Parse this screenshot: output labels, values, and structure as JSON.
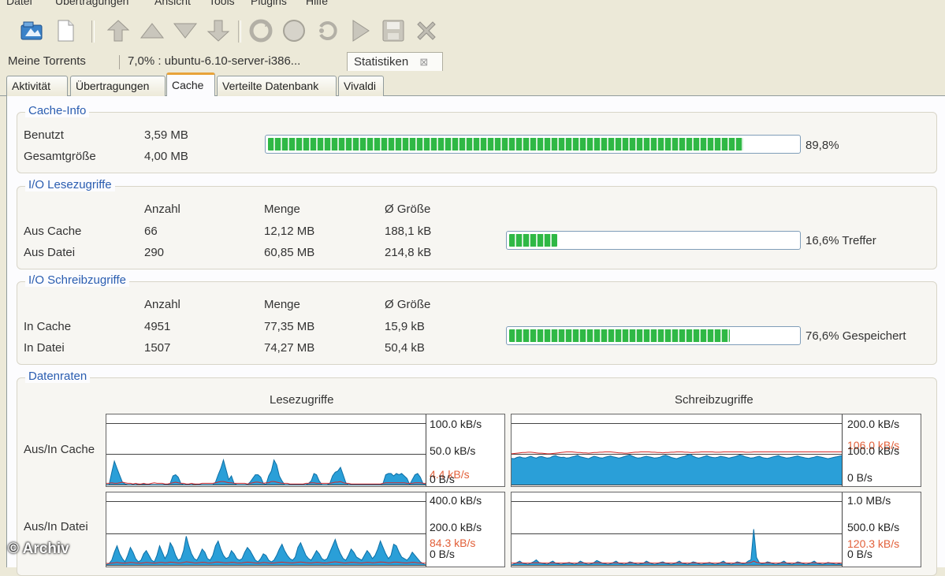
{
  "menubar": {
    "items": [
      "Datei",
      "Übertragungen",
      "Ansicht",
      "Tools",
      "Plugins",
      "Hilfe"
    ]
  },
  "toolbar": {
    "icons": [
      "open-torrent-icon",
      "new-torrent-icon",
      "move-top-icon",
      "move-up-icon",
      "move-down-icon",
      "move-bottom-icon",
      "run-icon",
      "start-icon",
      "stop-icon",
      "queue-icon",
      "save-icon",
      "remove-icon"
    ]
  },
  "doc_tabs": {
    "my_torrents": "Meine Torrents",
    "torrent": "7,0% : ubuntu-6.10-server-i386...",
    "statistics": "Statistiken",
    "close_glyph": "⊠"
  },
  "sub_tabs": [
    "Aktivität",
    "Übertragungen",
    "Cache",
    "Verteilte Datenbank",
    "Vivaldi"
  ],
  "cache_info": {
    "title": "Cache-Info",
    "used_label": "Benutzt",
    "used_value": "3,59 MB",
    "total_label": "Gesamtgröße",
    "total_value": "4,00 MB",
    "usage_percent": 89.8,
    "usage_text": "89,8%"
  },
  "io_read": {
    "title": "I/O Lesezugriffe",
    "headers": [
      "Anzahl",
      "Menge",
      "Ø Größe"
    ],
    "rows": [
      {
        "label": "Aus Cache",
        "count": "66",
        "amount": "12,12 MB",
        "avg": "188,1 kB"
      },
      {
        "label": "Aus Datei",
        "count": "290",
        "amount": "60,85 MB",
        "avg": "214,8 kB"
      }
    ],
    "percent": 16.6,
    "bar_text": "16,6% Treffer"
  },
  "io_write": {
    "title": "I/O Schreibzugriffe",
    "headers": [
      "Anzahl",
      "Menge",
      "Ø Größe"
    ],
    "rows": [
      {
        "label": "In Cache",
        "count": "4951",
        "amount": "77,35 MB",
        "avg": "15,9 kB"
      },
      {
        "label": "In Datei",
        "count": "1507",
        "amount": "74,27 MB",
        "avg": "50,4 kB"
      }
    ],
    "percent": 76.6,
    "bar_text": "76,6% Gespeichert"
  },
  "data_rates": {
    "title": "Datenraten",
    "read_header": "Lesezugriffe",
    "write_header": "Schreibzugriffe",
    "row_cache_label": "Aus/In Cache",
    "row_file_label": "Aus/In Datei",
    "read_cache_axis": {
      "top": "100.0 kB/s",
      "mid": "50.0 kB/s",
      "bottom": "0 B/s",
      "current": "4.4 kB/s"
    },
    "write_cache_axis": {
      "top": "200.0 kB/s",
      "mid": "100.0 kB/s",
      "bottom": "0 B/s",
      "current": "106.0 kB/s"
    },
    "read_file_axis": {
      "top": "400.0 kB/s",
      "mid": "200.0 kB/s",
      "bottom": "0 B/s",
      "current": "84.3 kB/s"
    },
    "write_file_axis": {
      "top": "1.0 MB/s",
      "mid": "500.0 kB/s",
      "bottom": "0 B/s",
      "current": "120.3 kB/s"
    }
  },
  "chart_data": [
    {
      "type": "area",
      "title": "Lesezugriffe – Aus/In Cache",
      "ylim": [
        0,
        100
      ],
      "unit": "kB/s",
      "values": [
        0,
        0,
        20,
        38,
        26,
        15,
        4,
        1,
        0,
        0,
        0,
        0,
        1,
        0,
        1,
        0,
        0,
        0,
        0,
        0,
        0,
        0,
        0,
        0,
        2,
        14,
        16,
        12,
        2,
        0,
        0,
        0,
        0,
        1,
        0,
        0,
        0,
        0,
        0,
        0,
        0,
        4,
        16,
        26,
        40,
        24,
        8,
        14,
        2,
        0,
        0,
        0,
        0,
        0,
        4,
        10,
        16,
        16,
        12,
        2,
        0,
        14,
        22,
        40,
        32,
        14,
        6,
        0,
        0,
        0,
        0,
        0,
        0,
        0,
        0,
        0,
        2,
        6,
        18,
        16,
        6,
        0,
        0,
        0,
        2,
        14,
        20,
        22,
        28,
        16,
        3,
        0,
        0,
        0,
        0,
        0,
        0,
        0,
        0,
        0,
        0,
        0,
        0,
        0,
        2,
        16,
        18,
        18,
        14,
        18,
        16,
        18,
        14,
        10,
        0,
        8,
        16,
        18,
        12,
        2,
        0
      ],
      "red": [
        2,
        2,
        3,
        2,
        2,
        3,
        4,
        3,
        2,
        2,
        1,
        2,
        1,
        1,
        2,
        1,
        1,
        2,
        3,
        2,
        2,
        2,
        1,
        1,
        2,
        3,
        4,
        3,
        2,
        2,
        1,
        1,
        2,
        1,
        1,
        1,
        2,
        2,
        2,
        2,
        2,
        3,
        4,
        5,
        5,
        4,
        3,
        3,
        2,
        2,
        2,
        2,
        2,
        1,
        2,
        3,
        4,
        4,
        3,
        2,
        3,
        3,
        5,
        5,
        4,
        3,
        2,
        2,
        2,
        1,
        1,
        1,
        1,
        1,
        1,
        2,
        2,
        3,
        3,
        2,
        2,
        2,
        2,
        2,
        2,
        3,
        4,
        4,
        5,
        3,
        2,
        2,
        1,
        1,
        1,
        1,
        1,
        1,
        1,
        1,
        1,
        1,
        1,
        1,
        2,
        3,
        3,
        3,
        3,
        3,
        3,
        3,
        3,
        2,
        2,
        2,
        3,
        3,
        3,
        2,
        2
      ]
    },
    {
      "type": "area",
      "title": "Schreibzugriffe – Aus/In Cache",
      "ylim": [
        0,
        200
      ],
      "unit": "kB/s",
      "values": [
        85,
        84,
        88,
        90,
        87,
        86,
        89,
        92,
        88,
        86,
        90,
        91,
        88,
        86,
        87,
        92,
        94,
        90,
        88,
        89,
        86,
        87,
        90,
        92,
        95,
        90,
        88,
        86,
        84,
        88,
        92,
        90,
        87,
        86,
        89,
        91,
        93,
        90,
        88,
        86,
        88,
        91,
        94,
        96,
        92,
        88,
        86,
        87,
        90,
        92,
        90,
        88,
        86,
        87,
        89,
        93,
        95,
        92,
        88,
        86,
        84,
        87,
        90,
        92,
        96,
        98,
        92,
        88,
        86,
        88,
        91,
        94,
        90,
        88,
        87,
        89,
        92,
        90,
        88,
        86,
        88,
        90,
        93,
        96,
        94,
        90,
        88,
        86,
        87,
        90,
        92,
        88,
        86,
        85,
        87,
        90,
        92,
        94,
        90,
        88,
        86,
        87,
        89,
        91,
        93,
        90,
        88,
        86,
        85,
        87,
        89,
        92,
        90,
        88,
        86,
        84,
        86,
        88,
        90,
        92,
        94
      ],
      "red": [
        100,
        101,
        102,
        103,
        104,
        104,
        105,
        105,
        104,
        103,
        102,
        102,
        101,
        100,
        100,
        101,
        102,
        103,
        104,
        105,
        106,
        106,
        106,
        105,
        104,
        104,
        103,
        103,
        102,
        103,
        104,
        104,
        105,
        105,
        106,
        106,
        106,
        105,
        104,
        103,
        103,
        102,
        102,
        103,
        104,
        105,
        105,
        106,
        106,
        106,
        106,
        105,
        105,
        104,
        104,
        103,
        104,
        104,
        105,
        105,
        106,
        106,
        106,
        105,
        105,
        104,
        104,
        105,
        105,
        106,
        106,
        106,
        106,
        106,
        105,
        105,
        105,
        106,
        106,
        106,
        106,
        106,
        106,
        106,
        106,
        105,
        105,
        105,
        106,
        106,
        106,
        106,
        106,
        106,
        106,
        106,
        106,
        106,
        106,
        106,
        106,
        106,
        106,
        106,
        106,
        106,
        106,
        106,
        106,
        106,
        106,
        106,
        106,
        106,
        106,
        106,
        106,
        106,
        106,
        106,
        106
      ]
    },
    {
      "type": "area",
      "title": "Lesezugriffe – Aus/In Datei",
      "ylim": [
        0,
        400
      ],
      "unit": "kB/s",
      "values": [
        0,
        10,
        30,
        80,
        120,
        70,
        40,
        20,
        60,
        110,
        80,
        40,
        20,
        30,
        70,
        90,
        60,
        30,
        20,
        60,
        120,
        80,
        40,
        70,
        140,
        110,
        60,
        30,
        40,
        90,
        180,
        120,
        70,
        40,
        30,
        60,
        100,
        80,
        40,
        30,
        60,
        120,
        150,
        100,
        60,
        40,
        50,
        90,
        70,
        40,
        30,
        40,
        80,
        110,
        90,
        60,
        30,
        20,
        40,
        70,
        60,
        30,
        20,
        30,
        60,
        100,
        130,
        90,
        60,
        40,
        30,
        50,
        110,
        140,
        100,
        60,
        40,
        30,
        60,
        90,
        70,
        40,
        30,
        40,
        80,
        120,
        160,
        110,
        70,
        40,
        30,
        60,
        100,
        80,
        50,
        40,
        30,
        60,
        90,
        70,
        40,
        60,
        100,
        150,
        110,
        70,
        40,
        60,
        130,
        120,
        80,
        50,
        40,
        30,
        50,
        80,
        60,
        40,
        20,
        10,
        0
      ],
      "red": [
        10,
        10,
        12,
        14,
        16,
        14,
        12,
        12,
        14,
        16,
        15,
        13,
        12,
        12,
        14,
        16,
        15,
        13,
        12,
        14,
        16,
        16,
        14,
        15,
        18,
        17,
        15,
        13,
        14,
        16,
        20,
        18,
        16,
        14,
        13,
        15,
        17,
        16,
        14,
        13,
        15,
        18,
        19,
        17,
        15,
        14,
        15,
        17,
        16,
        14,
        13,
        14,
        16,
        18,
        17,
        15,
        13,
        12,
        14,
        16,
        15,
        13,
        12,
        13,
        15,
        17,
        18,
        16,
        15,
        14,
        13,
        15,
        17,
        19,
        17,
        15,
        14,
        13,
        15,
        17,
        16,
        14,
        13,
        14,
        16,
        18,
        20,
        18,
        16,
        14,
        13,
        15,
        17,
        16,
        15,
        14,
        13,
        15,
        17,
        16,
        14,
        15,
        17,
        19,
        18,
        16,
        14,
        15,
        18,
        18,
        17,
        15,
        14,
        13,
        15,
        17,
        16,
        14,
        13,
        12,
        12
      ]
    },
    {
      "type": "area",
      "title": "Schreibzugriffe – Aus/In Datei",
      "ylim": [
        0,
        1000
      ],
      "unit": "kB/s",
      "values": [
        0,
        20,
        40,
        60,
        30,
        20,
        10,
        30,
        50,
        80,
        40,
        30,
        20,
        10,
        40,
        60,
        30,
        20,
        10,
        20,
        30,
        40,
        20,
        10,
        30,
        60,
        40,
        20,
        10,
        20,
        40,
        70,
        50,
        30,
        20,
        10,
        20,
        40,
        60,
        30,
        20,
        10,
        30,
        50,
        40,
        20,
        10,
        20,
        30,
        60,
        40,
        20,
        10,
        20,
        40,
        50,
        30,
        20,
        10,
        20,
        40,
        60,
        30,
        20,
        10,
        30,
        50,
        40,
        20,
        10,
        20,
        30,
        40,
        20,
        10,
        20,
        40,
        60,
        30,
        20,
        10,
        30,
        50,
        40,
        20,
        30,
        60,
        80,
        560,
        120,
        40,
        20,
        30,
        50,
        40,
        20,
        10,
        20,
        40,
        60,
        30,
        20,
        10,
        30,
        50,
        40,
        20,
        10,
        20,
        40,
        60,
        30,
        20,
        10,
        20,
        40,
        30,
        20,
        10,
        20,
        10
      ],
      "red": [
        30,
        30,
        32,
        34,
        32,
        30,
        30,
        31,
        33,
        36,
        34,
        32,
        31,
        30,
        32,
        34,
        32,
        31,
        30,
        31,
        32,
        33,
        31,
        30,
        31,
        34,
        33,
        31,
        30,
        31,
        33,
        36,
        34,
        32,
        31,
        30,
        31,
        33,
        35,
        32,
        31,
        30,
        31,
        33,
        32,
        31,
        30,
        31,
        32,
        35,
        33,
        31,
        30,
        31,
        33,
        34,
        32,
        31,
        30,
        31,
        33,
        35,
        32,
        31,
        30,
        31,
        33,
        32,
        31,
        30,
        31,
        32,
        33,
        31,
        30,
        31,
        33,
        35,
        32,
        31,
        30,
        31,
        33,
        32,
        31,
        32,
        35,
        38,
        60,
        40,
        33,
        31,
        32,
        33,
        32,
        31,
        30,
        31,
        33,
        35,
        32,
        31,
        30,
        31,
        33,
        32,
        31,
        30,
        31,
        33,
        35,
        32,
        31,
        30,
        31,
        33,
        32,
        31,
        30,
        31,
        30
      ]
    }
  ],
  "watermark": "© Archiv"
}
